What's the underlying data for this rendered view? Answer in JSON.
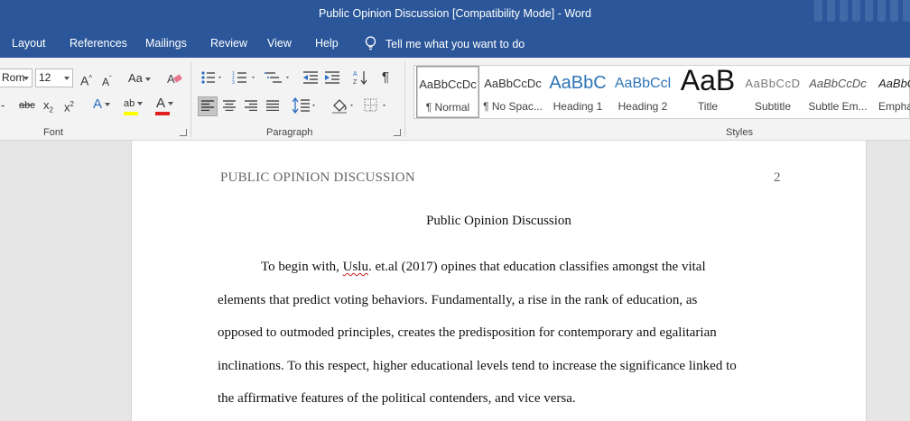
{
  "window": {
    "title": "Public Opinion Discussion [Compatibility Mode]  -  Word"
  },
  "tabs": [
    "Layout",
    "References",
    "Mailings",
    "Review",
    "View",
    "Help"
  ],
  "tell_me": "Tell me what you want to do",
  "font_group": {
    "font_name": "Rom",
    "font_size": "12",
    "label": "Font"
  },
  "paragraph_group": {
    "label": "Paragraph"
  },
  "styles_group": {
    "label": "Styles",
    "items": [
      {
        "sample": "AaBbCcDc",
        "name": "¶ Normal"
      },
      {
        "sample": "AaBbCcDc",
        "name": "¶ No Spac..."
      },
      {
        "sample": "AaBbC",
        "name": "Heading 1"
      },
      {
        "sample": "AaBbCcl",
        "name": "Heading 2"
      },
      {
        "sample": "AaB",
        "name": "Title"
      },
      {
        "sample": "AaBbCcD",
        "name": "Subtitle"
      },
      {
        "sample": "AaBbCcDc",
        "name": "Subtle Em..."
      },
      {
        "sample": "AaBbCcDc",
        "name": "Empha..."
      }
    ]
  },
  "document": {
    "header": "PUBLIC OPINION DISCUSSION",
    "page_number": "2",
    "title": "Public Opinion Discussion",
    "lines": [
      {
        "before": "To begin with, ",
        "flagged": "Uslu",
        "after": ". et.al (2017) opines that education classifies amongst the vital"
      },
      {
        "text": "elements that predict voting behaviors. Fundamentally, a rise in the rank of education, as"
      },
      {
        "text": "opposed to outmoded principles, creates the predisposition for contemporary and egalitarian"
      },
      {
        "text": "inclinations. To this respect, higher educational levels tend to increase the significance linked to"
      },
      {
        "text": "the affirmative features of the political contenders, and vice versa."
      }
    ]
  },
  "colors": {
    "title_bar": "#2b579a",
    "ribbon": "#f3f3f3",
    "font_color_bar": "#e02020",
    "highlight_bar": "#ffff00"
  }
}
